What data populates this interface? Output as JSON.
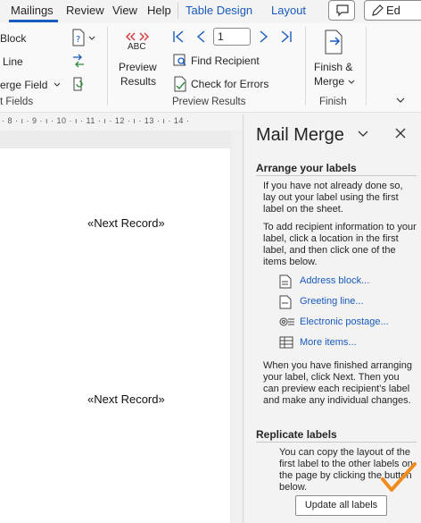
{
  "tabs": [
    {
      "label": "Mailings",
      "active": true
    },
    {
      "label": "Review"
    },
    {
      "label": "View"
    },
    {
      "label": "Help"
    },
    {
      "label": "Table Design",
      "contextual": true
    },
    {
      "label": "Layout",
      "contextual": true
    }
  ],
  "top_right": {
    "editing_label": "Ed"
  },
  "ribbon": {
    "write_insert": {
      "address_block": "Block",
      "greeting_line": "Line",
      "insert_merge_field": "erge Field",
      "group_label": "t Fields"
    },
    "preview": {
      "abc_label": "ABC",
      "preview_results_line1": "Preview",
      "preview_results_line2": "Results",
      "record_value": "1",
      "find_recipient": "Find Recipient",
      "check_errors": "Check for Errors",
      "group_label": "Preview Results"
    },
    "finish": {
      "label_line1": "Finish &",
      "label_line2": "Merge",
      "group_label": "Finish"
    }
  },
  "ruler": {
    "label": "· 8 · ı · 9 · ı · 10 · ı · 11 · ı · 12 · ı · 13 · ı · 14 ·"
  },
  "document": {
    "records": [
      "«Next Record»",
      "«Next Record»"
    ]
  },
  "pane": {
    "title": "Mail Merge",
    "section1": {
      "heading": "Arrange your labels",
      "para1": "If you have not already done so, lay out your label using the first label on the sheet.",
      "para2": "To add recipient information to your label, click a location in the first label, and then click one of the items below.",
      "links": [
        {
          "label": "Address block...",
          "icon": "address-block-icon"
        },
        {
          "label": "Greeting line...",
          "icon": "greeting-line-icon"
        },
        {
          "label": "Electronic postage...",
          "icon": "postage-icon"
        },
        {
          "label": "More items...",
          "icon": "more-items-icon"
        }
      ],
      "para3": "When you have finished arranging your label, click Next. Then you can preview each recipient's label and make any individual changes."
    },
    "section2": {
      "heading": "Replicate labels",
      "para": "You can copy the layout of the first label to the other labels on the page by clicking the button below.",
      "button": "Update all labels"
    }
  },
  "colors": {
    "accent": "#185abd",
    "annotation": "#f08c1e"
  }
}
